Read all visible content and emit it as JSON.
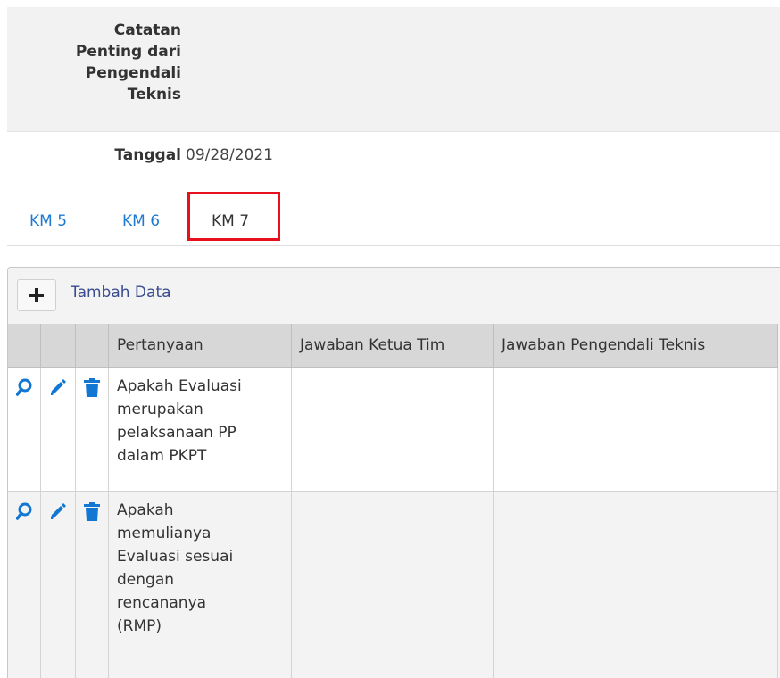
{
  "form": {
    "notes_label_lines": [
      "Catatan",
      "Penting dari",
      "Pengendali",
      "Teknis"
    ],
    "date_label": "Tanggal",
    "date_value": "09/28/2021"
  },
  "tabs": [
    {
      "label": "KM 5",
      "active": false
    },
    {
      "label": "KM 6",
      "active": false
    },
    {
      "label": "KM 7",
      "active": true
    }
  ],
  "highlight_color": "#e8101a",
  "toolbar": {
    "add_icon": "plus-icon",
    "add_label": "Tambah Data"
  },
  "table": {
    "columns": [
      "Pertanyaan",
      "Jawaban Ketua Tim",
      "Jawaban Pengendali Teknis"
    ],
    "row_actions": [
      "search-icon",
      "pencil-icon",
      "trash-icon"
    ],
    "rows": [
      {
        "pertanyaan_lines": [
          "Apakah Evaluasi",
          "merupakan",
          "pelaksanaan PP",
          "dalam PKPT"
        ],
        "jawaban_ketua_tim": "",
        "jawaban_pengendali_teknis": ""
      },
      {
        "pertanyaan_lines": [
          "Apakah",
          "memulianya",
          "Evaluasi sesuai",
          "dengan",
          "rencananya",
          "(RMP)"
        ],
        "jawaban_ketua_tim": "",
        "jawaban_pengendali_teknis": ""
      }
    ]
  },
  "icon_color": "#1276d3"
}
